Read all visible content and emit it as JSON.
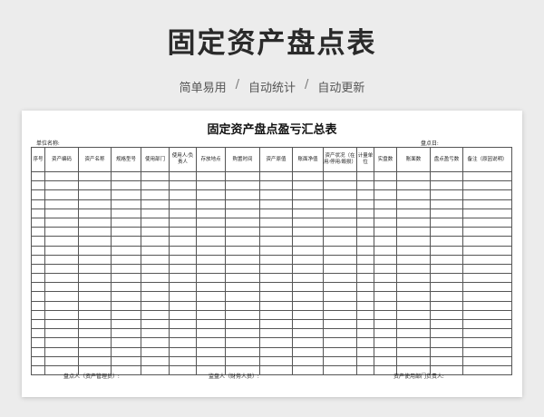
{
  "hero": {
    "title": "固定资产盘点表",
    "tags": [
      "简单易用",
      "自动统计",
      "自动更新"
    ],
    "separator": "/"
  },
  "sheet": {
    "title": "固定资产盘点盈亏汇总表",
    "unit_label": "单位名称:",
    "date_label": "盘点日:",
    "columns": [
      "序号",
      "资产编码",
      "资产名称",
      "规格型号",
      "使用部门",
      "使用人/负责人",
      "存放地点",
      "购置时间",
      "资产原值",
      "账面净值",
      "资产状况（在用/停用/毁损）",
      "计量单位",
      "实盘数",
      "账面数",
      "盘点盈亏数",
      "备注（原因说明）"
    ],
    "row_count": 22,
    "footer": {
      "counter": "盘点人（资产管理员）:",
      "supervisor": "监盘人（财务人员）:",
      "dept_head": "资产使用部门负责人:"
    }
  }
}
